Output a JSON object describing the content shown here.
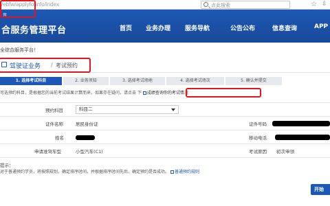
{
  "browser": {
    "url": "/ebfw/applyforinfo/index",
    "search_placeholder": "点此搜索"
  },
  "header": {
    "subtitle": "音",
    "title": "合服务管理平台",
    "nav": [
      "首页",
      "业务办理",
      "服务导航",
      "公告公布",
      "信息查询",
      "APP"
    ]
  },
  "welcome": "全综合服务平台！",
  "breadcrumb": {
    "section": "驾驶证业务",
    "separator": "/",
    "current": "考试预约"
  },
  "steps": [
    "1. 选择考试科目",
    "2. 业务须知",
    "3. 选择考试场地",
    "4. 选择考试场次",
    "5. 确认并提交"
  ],
  "notice": {
    "text": "可选预约科目，是根据您的当前考试结果计算而来，如果存在疑问，请点击",
    "link_prefix": "下",
    "link": "成绩查询你的考试情况"
  },
  "form": {
    "subject_label": "预约科目",
    "subject_value": "科目二",
    "id_type_label": "证件名称",
    "id_type_value": "居民身份证",
    "id_number_label": "证件号码",
    "name_label": "姓名",
    "phone_label": "移动电话",
    "vehicle_label": "申请准驾车型",
    "vehicle_value": "小型汽车(C1)",
    "reason_label": "考试原因",
    "reason_value": "初次申领"
  },
  "tips": {
    "heading": "提示：",
    "text": "对于普通预约学员，将按照规划，确定排序时间，并根据排序时间先后，确定预约是否成功。",
    "link": "普通预约规则"
  },
  "actions": {
    "next_label": "开始"
  },
  "colors": {
    "brand": "#1d58b4",
    "annotation": "#e4141c"
  }
}
